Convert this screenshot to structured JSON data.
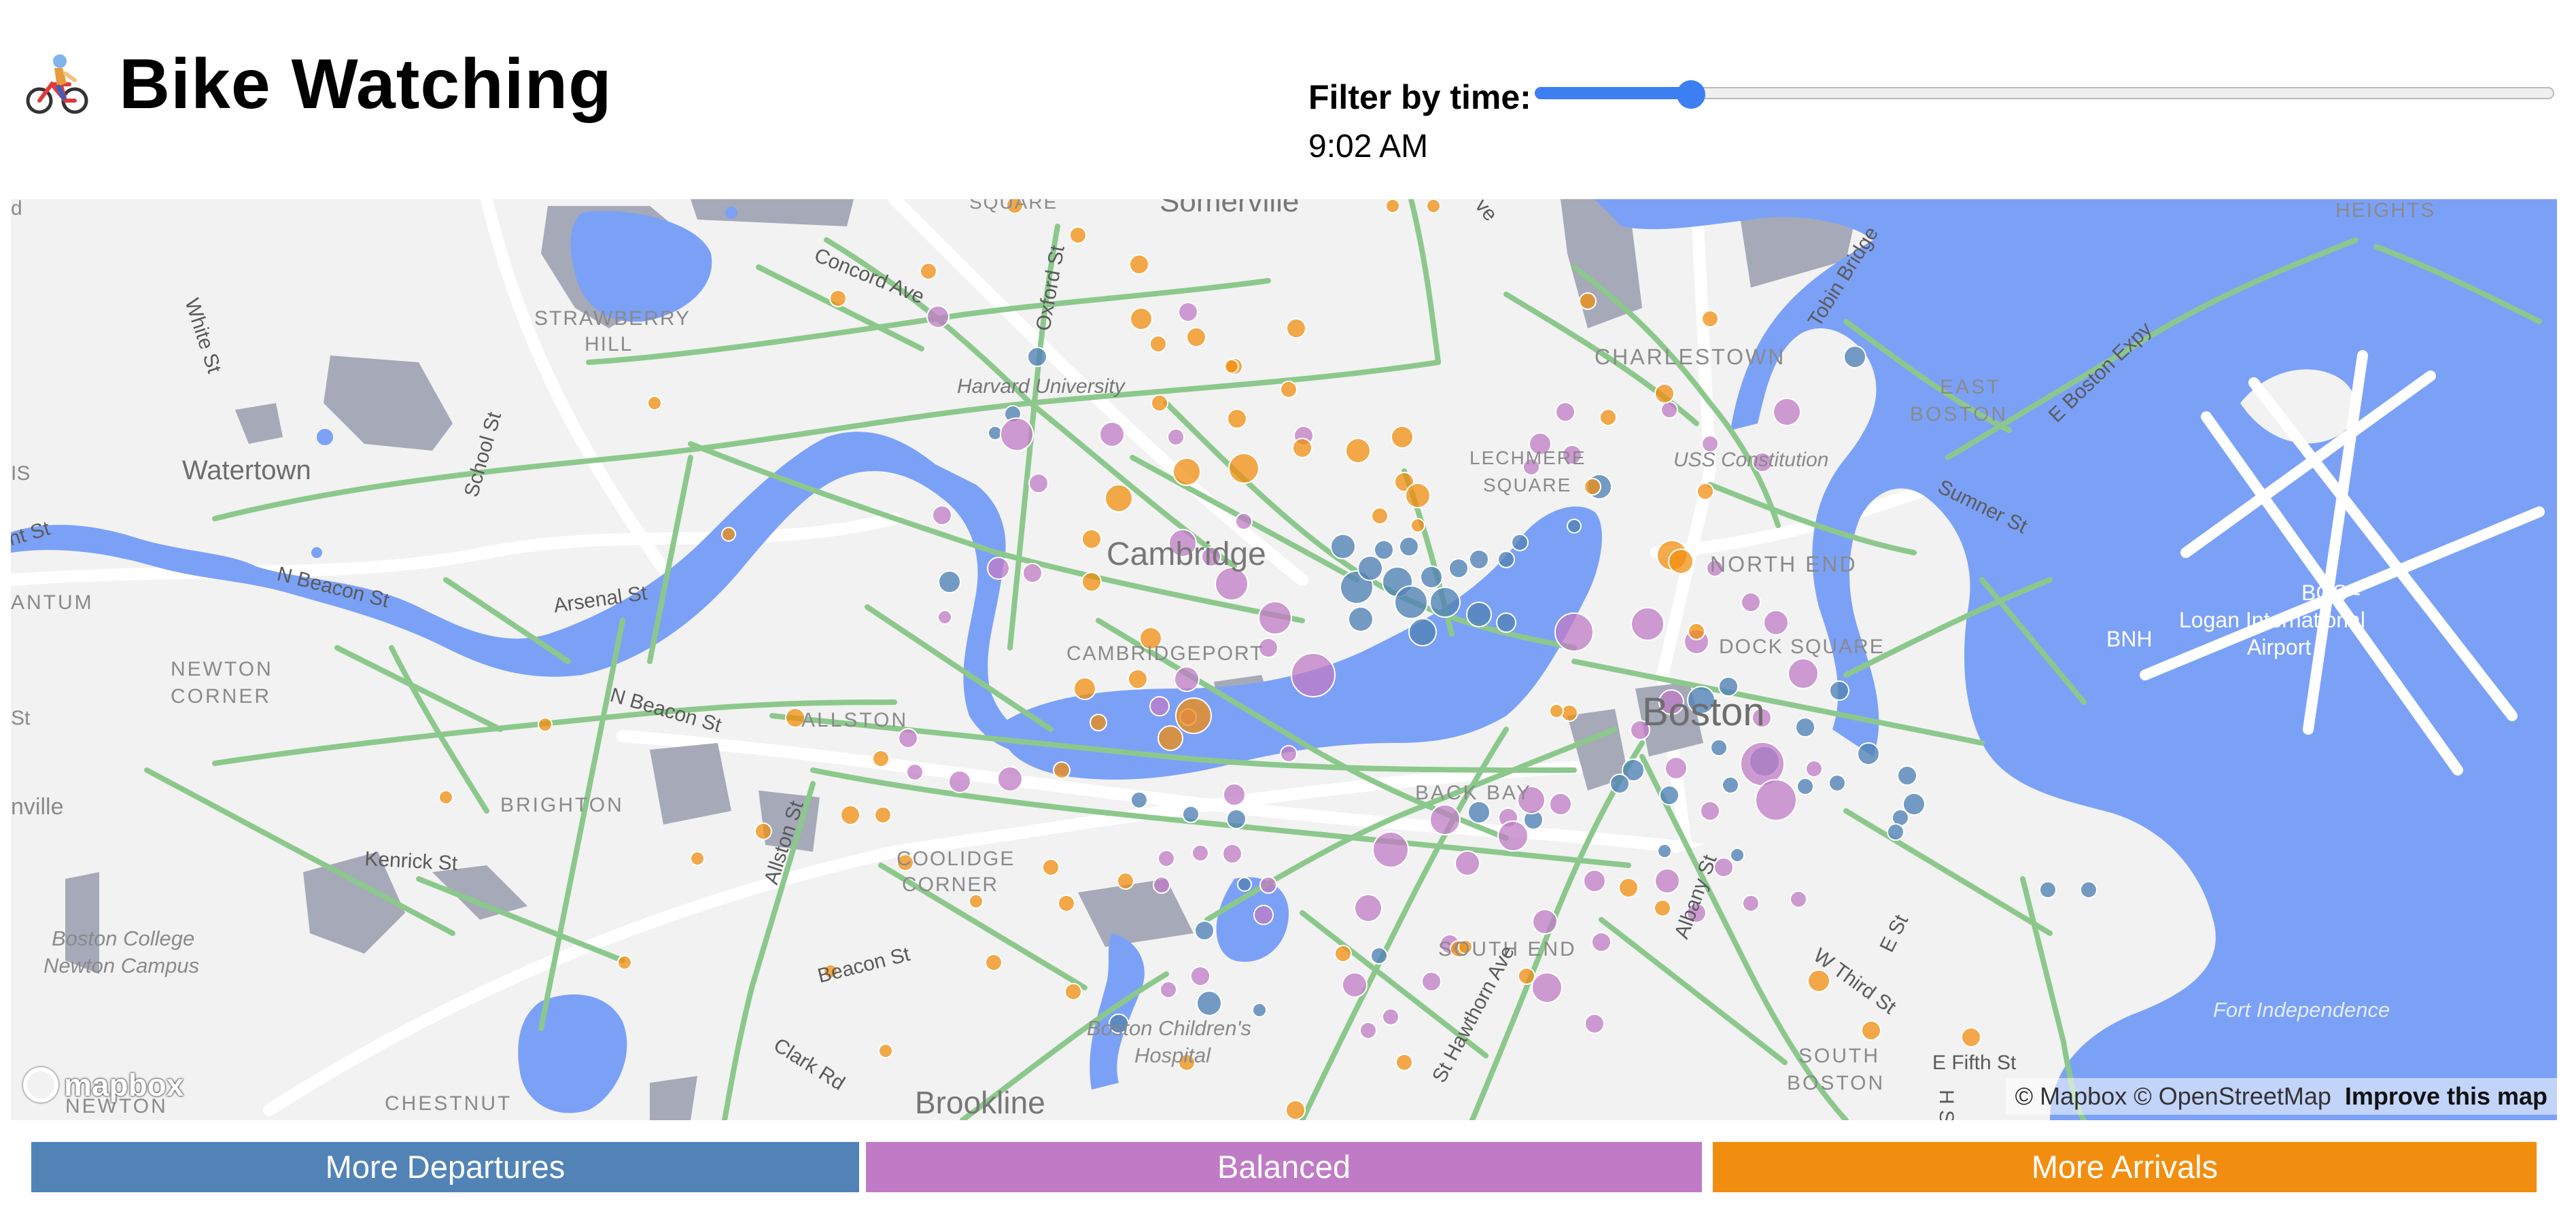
{
  "header": {
    "title": "Bike Watching",
    "filter_label": "Filter by time:",
    "time_value": "9:02 AM",
    "slider_fraction": 0.153
  },
  "map": {
    "attribution_text": "© Mapbox © OpenStreetMap",
    "improve_link": "Improve this map",
    "logo_text": "mapbox",
    "place_labels": [
      {
        "text": "Somerville",
        "id": "somerville"
      },
      {
        "text": "Cambridge",
        "id": "cambridge"
      },
      {
        "text": "Boston",
        "id": "boston"
      },
      {
        "text": "Brookline",
        "id": "brookline"
      },
      {
        "text": "Watertown",
        "id": "watertown"
      },
      {
        "text": "Harvard University",
        "id": "harvard"
      },
      {
        "text": "STRAWBERRY",
        "id": "strawberry"
      },
      {
        "text": "HILL",
        "id": "hill"
      },
      {
        "text": "CHARLESTOWN",
        "id": "charlestown"
      },
      {
        "text": "EAST",
        "id": "east"
      },
      {
        "text": "BOSTON",
        "id": "eastboston"
      },
      {
        "text": "NORTH END",
        "id": "northend"
      },
      {
        "text": "CAMBRIDGEPORT",
        "id": "cambridgeport"
      },
      {
        "text": "ALLSTON",
        "id": "allston"
      },
      {
        "text": "BRIGHTON",
        "id": "brighton"
      },
      {
        "text": "NEWTON",
        "id": "newton"
      },
      {
        "text": "CORNER",
        "id": "corner"
      },
      {
        "text": "COOLIDGE",
        "id": "coolidge"
      },
      {
        "text": "CORNER",
        "id": "corner2"
      },
      {
        "text": "BACK BAY",
        "id": "backbay"
      },
      {
        "text": "SOUTH END",
        "id": "southend"
      },
      {
        "text": "SOUTH",
        "id": "south"
      },
      {
        "text": "BOSTON",
        "id": "southboston"
      },
      {
        "text": "CHESTNUT",
        "id": "chestnut"
      },
      {
        "text": "NEWTON",
        "id": "newton2"
      },
      {
        "text": "ANTUM",
        "id": "antum"
      },
      {
        "text": "HEIGHTS",
        "id": "heights"
      },
      {
        "text": "DOCK SQUARE",
        "id": "docksq"
      },
      {
        "text": "LECHMERE",
        "id": "lechmere"
      },
      {
        "text": "SQUARE",
        "id": "lechsq"
      },
      {
        "text": "SQUARE",
        "id": "topsq"
      },
      {
        "text": "USS Constitution",
        "id": "uss"
      },
      {
        "text": "Boston College",
        "id": "bc1"
      },
      {
        "text": "Newton Campus",
        "id": "bc2"
      },
      {
        "text": "Boston Children's",
        "id": "bch1"
      },
      {
        "text": "Hospital",
        "id": "bch2"
      },
      {
        "text": "Fort Independence",
        "id": "fortind"
      },
      {
        "text": "BOS -",
        "id": "bos"
      },
      {
        "text": "Logan International",
        "id": "logan1"
      },
      {
        "text": "Airport",
        "id": "logan2"
      },
      {
        "text": "BNH",
        "id": "bnh"
      },
      {
        "text": "nville",
        "id": "nville"
      },
      {
        "text": "IS",
        "id": "is"
      },
      {
        "text": "St",
        "id": "st"
      },
      {
        "text": "d",
        "id": "d"
      }
    ],
    "street_labels": [
      {
        "text": "White St",
        "id": "white"
      },
      {
        "text": "School St",
        "id": "school"
      },
      {
        "text": "Concord Ave",
        "id": "concord"
      },
      {
        "text": "Oxford St",
        "id": "oxford"
      },
      {
        "text": "N Beacon St",
        "id": "nbeacon1"
      },
      {
        "text": "N Beacon St",
        "id": "nbeacon2"
      },
      {
        "text": "Arsenal St",
        "id": "arsenal"
      },
      {
        "text": "Allston St",
        "id": "allstonst"
      },
      {
        "text": "Kenrick St",
        "id": "kenrick"
      },
      {
        "text": "Beacon St",
        "id": "beacon"
      },
      {
        "text": "Clark Rd",
        "id": "clark"
      },
      {
        "text": "Tobin Bridge",
        "id": "tobin"
      },
      {
        "text": "E Boston Expy",
        "id": "eboston"
      },
      {
        "text": "Sumner St",
        "id": "sumner"
      },
      {
        "text": "Albany St",
        "id": "albany"
      },
      {
        "text": "E St",
        "id": "est"
      },
      {
        "text": "W Third St",
        "id": "wthird"
      },
      {
        "text": "E Fifth St",
        "id": "efifth"
      },
      {
        "text": "St Hawthorn Ave",
        "id": "hawthorn"
      },
      {
        "text": "H St",
        "id": "hst"
      },
      {
        "text": "ve",
        "id": "ve"
      },
      {
        "text": "nt St",
        "id": "ntst"
      }
    ]
  },
  "legend": {
    "departures": "More Departures",
    "balanced": "Balanced",
    "arrivals": "More Arrivals"
  },
  "colors": {
    "departures": "#5283b7",
    "balanced": "#c07bc6",
    "arrivals": "#f28e0f",
    "water": "#7ba1f7",
    "bike_lanes": "#8cc88c",
    "land": "#f2f2f2",
    "buildings": "#a5a9b8"
  },
  "icons": {
    "logo": "cyclist-emoji-icon",
    "mapbox": "mapbox-logo-icon"
  }
}
